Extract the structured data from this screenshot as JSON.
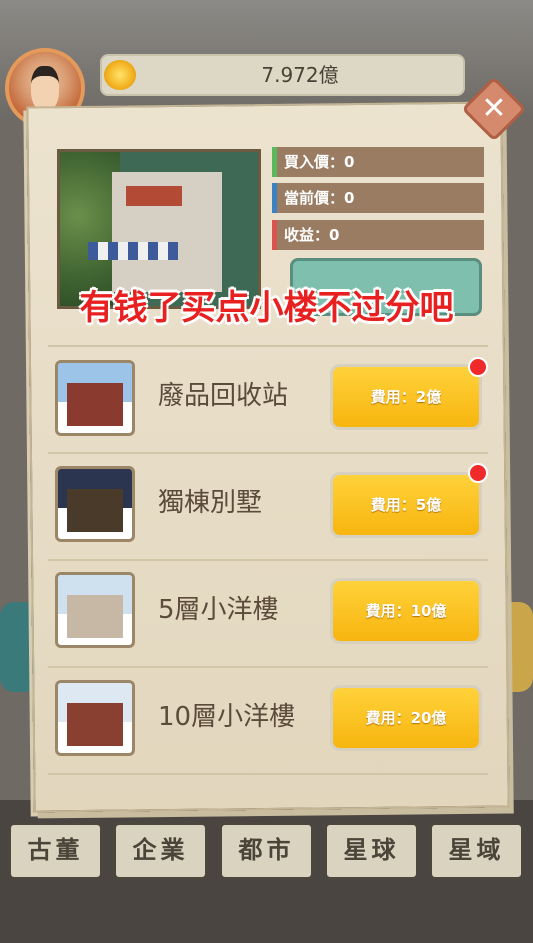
{
  "header": {
    "money": "7.972億"
  },
  "stats": {
    "buy_price": "買入價：0",
    "current_price": "當前價：0",
    "profit": "收益：0"
  },
  "overlay_caption": "有钱了买点小楼不过分吧",
  "items": [
    {
      "name": "廢品回收站",
      "cost": "費用：2億",
      "has_badge": true
    },
    {
      "name": "獨棟別墅",
      "cost": "費用：5億",
      "has_badge": true
    },
    {
      "name": "5層小洋樓",
      "cost": "費用：10億",
      "has_badge": false
    },
    {
      "name": "10層小洋樓",
      "cost": "費用：20億",
      "has_badge": false
    }
  ],
  "nav": [
    "古董",
    "企業",
    "都市",
    "星球",
    "星域"
  ],
  "colors": {
    "cost_button": "#f7b50f",
    "stat_bar_green": "#5cb85c",
    "stat_bar_blue": "#3b82c4",
    "stat_bar_red": "#d9534f",
    "caption": "#e82020"
  },
  "icons": {
    "close": "close-icon",
    "money": "gold-ingot-icon"
  }
}
